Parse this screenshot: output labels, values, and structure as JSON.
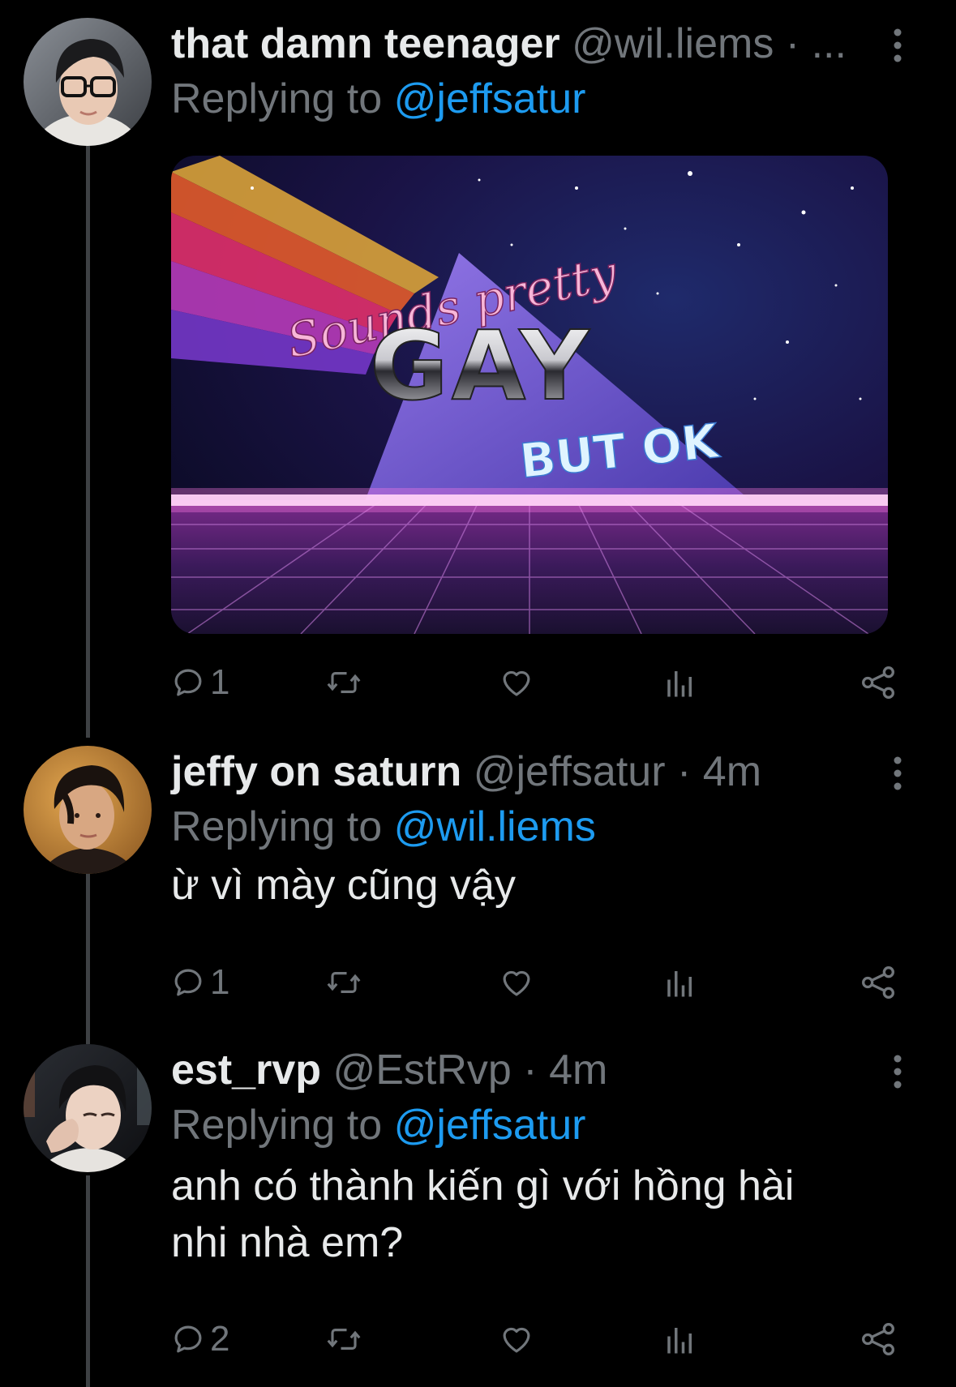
{
  "tweets": [
    {
      "display_name": "that damn teenager",
      "handle": "@wil.liems",
      "separator": "·",
      "time": "...",
      "replying_prefix": "Replying to",
      "replying_to": "@jeffsatur",
      "body": "",
      "media": {
        "line1": "Sounds pretty",
        "line2": "GAY",
        "line3": "BUT OK"
      },
      "stats": {
        "replies": "1",
        "retweets": "",
        "likes": ""
      }
    },
    {
      "display_name": "jeffy on saturn",
      "handle": "@jeffsatur",
      "separator": "·",
      "time": "4m",
      "replying_prefix": "Replying to",
      "replying_to": "@wil.liems",
      "body": "ừ vì mày cũng vậy",
      "stats": {
        "replies": "1",
        "retweets": "",
        "likes": ""
      }
    },
    {
      "display_name": "est_rvp",
      "handle": "@EstRvp",
      "separator": "·",
      "time": "4m",
      "replying_prefix": "Replying to",
      "replying_to": "@jeffsatur",
      "body": "anh có thành kiến gì với hồng hài nhi nhà em?",
      "stats": {
        "replies": "2",
        "retweets": "",
        "likes": ""
      }
    }
  ],
  "icons": {
    "reply": "reply-icon",
    "retweet": "retweet-icon",
    "like": "heart-icon",
    "views": "views-icon",
    "share": "share-icon",
    "more": "more-icon"
  },
  "colors": {
    "background": "#000000",
    "text": "#e7e9ea",
    "secondary": "#71767b",
    "link": "#1d9bf0"
  }
}
